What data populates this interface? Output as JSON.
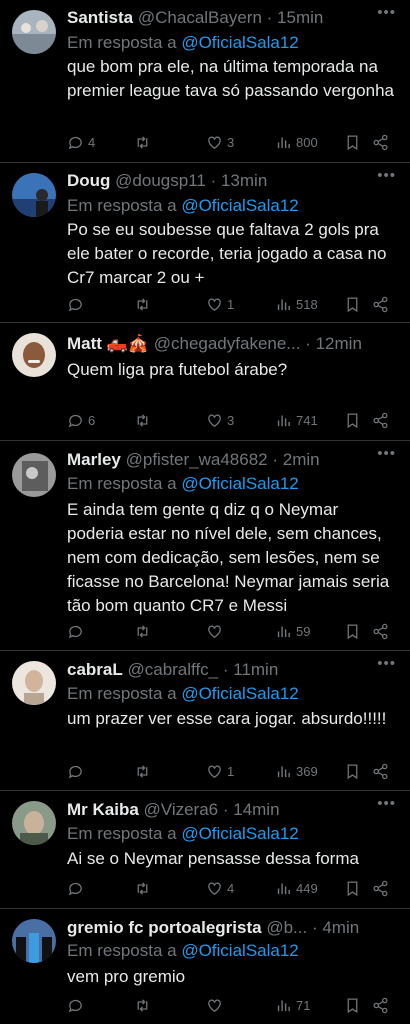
{
  "reply_prefix": "Em resposta a ",
  "tweets": [
    {
      "name": "Santista",
      "handle": "@ChacalBayern",
      "time": "15min",
      "reply_to": "@OficialSala12",
      "text": "que bom pra ele, na última temporada na premier league tava só passando vergonha",
      "replies": "4",
      "retweets": "",
      "likes": "3",
      "views": "800",
      "avatar_color": "#a8b4bf"
    },
    {
      "name": "Doug",
      "handle": "@dougsp11",
      "time": "13min",
      "reply_to": "@OficialSala12",
      "text": "Po se eu soubesse que faltava 2 gols pra ele bater o recorde, teria jogado a casa no Cr7 marcar 2 ou +",
      "replies": "",
      "retweets": "",
      "likes": "1",
      "views": "518",
      "avatar_color": "#3b73b9"
    },
    {
      "name": "Matt 🛻🎪",
      "handle": "@chegadyfakene...",
      "time": "12min",
      "reply_to": "",
      "text": "Quem liga pra futebol árabe?",
      "replies": "6",
      "retweets": "",
      "likes": "3",
      "views": "741",
      "avatar_color": "#c9a27e"
    },
    {
      "name": "Marley",
      "handle": "@pfister_wa48682",
      "time": "2min",
      "reply_to": "@OficialSala12",
      "text": "E ainda tem gente q diz q o Neymar poderia estar no nível dele, sem chances, nem com dedicação, sem lesões, nem se ficasse no Barcelona! Neymar jamais seria tão bom quanto CR7 e Messi",
      "replies": "",
      "retweets": "",
      "likes": "",
      "views": "59",
      "avatar_color": "#7a7a7a"
    },
    {
      "name": "cabraL",
      "handle": "@cabralffc_",
      "time": "11min",
      "reply_to": "@OficialSala12",
      "text": "um prazer ver esse cara jogar. absurdo!!!!!",
      "replies": "",
      "retweets": "",
      "likes": "1",
      "views": "369",
      "avatar_color": "#d8c2ab"
    },
    {
      "name": "Mr Kaiba",
      "handle": "@Vizera6",
      "time": "14min",
      "reply_to": "@OficialSala12",
      "text": "Ai se o Neymar pensasse dessa forma",
      "replies": "",
      "retweets": "",
      "likes": "4",
      "views": "449",
      "avatar_color": "#8a9a88"
    },
    {
      "name": "gremio fc portoalegrista",
      "handle": "@b...",
      "time": "4min",
      "reply_to": "@OficialSala12",
      "text": "vem pro gremio",
      "replies": "",
      "retweets": "",
      "likes": "",
      "views": "71",
      "avatar_color": "#4a6fa5"
    }
  ]
}
